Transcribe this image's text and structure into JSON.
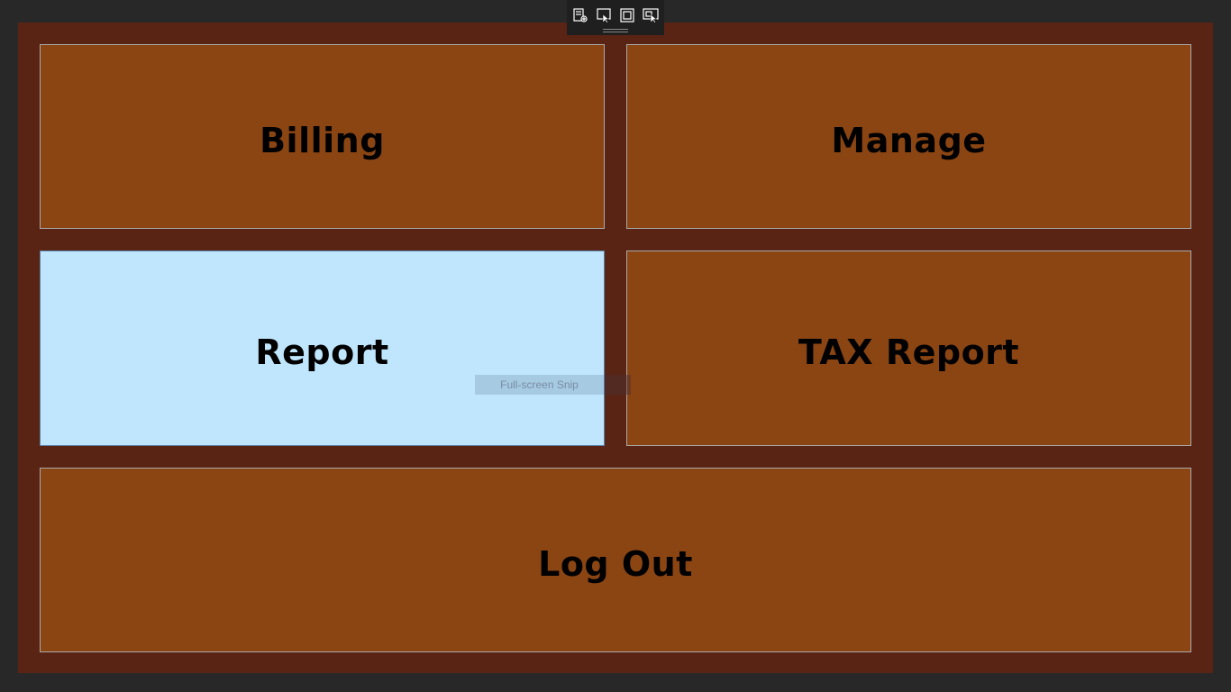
{
  "tiles": {
    "billing": "Billing",
    "manage": "Manage",
    "report": "Report",
    "tax_report": "TAX Report",
    "logout": "Log Out"
  },
  "snip_toolbar": {
    "buttons": [
      {
        "icon": "rectangular-snip-icon"
      },
      {
        "icon": "freeform-snip-icon"
      },
      {
        "icon": "window-snip-icon"
      },
      {
        "icon": "fullscreen-snip-icon"
      }
    ],
    "tooltip": "Full-screen Snip"
  },
  "colors": {
    "desktop_bg": "#282828",
    "window_bg": "#5a2414",
    "tile_bg": "#8b4513",
    "tile_hover_bg": "#bfe6fd",
    "toolbar_bg": "#1f1f1f"
  }
}
